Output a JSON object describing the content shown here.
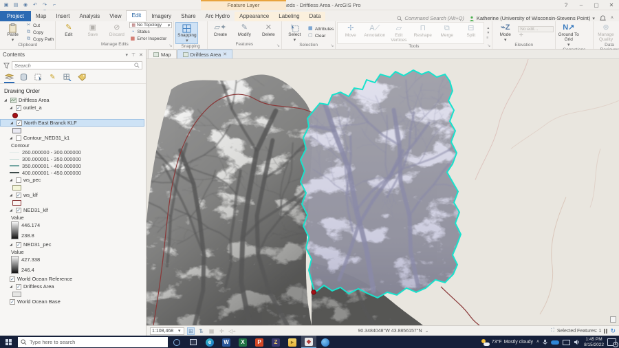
{
  "titlebar": {
    "title": "TwoWatersheds - Driftless Area - ArcGIS Pro",
    "contextual_tab_group": "Feature Layer",
    "help": "?"
  },
  "ribbon": {
    "tabs": [
      "Project",
      "Map",
      "Insert",
      "Analysis",
      "View",
      "Edit",
      "Imagery",
      "Share",
      "Arc Hydro",
      "Appearance",
      "Labeling",
      "Data"
    ],
    "active_tab": "Edit",
    "command_search": "Command Search (Alt+Q)",
    "user": "Katherine (University of Wisconsin-Stevens Point)",
    "groups": {
      "clipboard": {
        "label": "Clipboard",
        "paste": "Paste",
        "cut": "Cut",
        "copy": "Copy",
        "copy_path": "Copy Path"
      },
      "manage_edits": {
        "label": "Manage Edits",
        "edit": "Edit",
        "save": "Save",
        "discard": "Discard",
        "topology": "No Topology",
        "status": "Status",
        "error_inspector": "Error Inspector"
      },
      "snapping": {
        "label": "Snapping",
        "button": "Snapping"
      },
      "features": {
        "label": "Features",
        "create": "Create",
        "modify": "Modify",
        "delete": "Delete"
      },
      "selection": {
        "label": "Selection",
        "select": "Select",
        "attributes": "Attributes",
        "clear": "Clear"
      },
      "tools": {
        "label": "Tools",
        "move": "Move",
        "annotation": "Annotation",
        "edit_vertices": "Edit Vertices",
        "reshape": "Reshape",
        "merge": "Merge",
        "split": "Split"
      },
      "elevation": {
        "label": "Elevation",
        "mode": "Mode",
        "field_placeholder": "No edit..."
      },
      "corrections": {
        "label": "Corrections",
        "ground_to_grid": "Ground To Grid"
      },
      "data_reviewer": {
        "label": "Data Reviewer",
        "manage_quality": "Manage Quality"
      }
    }
  },
  "contents": {
    "title": "Contents",
    "search_placeholder": "Search",
    "drawing_order": "Drawing Order",
    "layers": {
      "map_group": "Driftless Area",
      "outlet": "outlet_a",
      "north_east": "North East Branck KLF",
      "contour": "Contour_NED31_k1",
      "contour_heading": "Contour",
      "contour_classes": [
        "260.000000 - 300.000000",
        "300.000001 - 350.000000",
        "350.000001 - 400.000000",
        "400.000001 - 450.000000"
      ],
      "ws_pec": "ws_pec",
      "ws_klf": "ws_klf",
      "ned_klf": "NED31_klf",
      "ned_klf_value": "Value",
      "ned_klf_max": "446.174",
      "ned_klf_min": "238.8",
      "ned_pec": "NED31_pec",
      "ned_pec_value": "Value",
      "ned_pec_max": "427.338",
      "ned_pec_min": "246.4",
      "world_ocean_reference": "World Ocean Reference",
      "driftless_area": "Driftless Area",
      "world_ocean_base": "World Ocean Base"
    }
  },
  "map": {
    "tab_map": "Map",
    "tab_view": "Driftless Area",
    "scale": "1:108,468",
    "coordinates": "90.3484048°W 43.8856157°N",
    "selected_features": "Selected Features: 1",
    "colors": {
      "selection_outline": "#17e3cd",
      "watershed_boundary": "#8a3838",
      "outlet_point": "#a50f15",
      "selected_fill": "#d7d7e8",
      "basemap": "#e9e6df",
      "contour_class_colors": [
        "#e3ebe9",
        "#bcd7d2",
        "#74a6a2",
        "#3d4a4a"
      ]
    }
  },
  "taskbar": {
    "search_placeholder": "Type here to search",
    "temperature": "73°F",
    "condition": "Mostly cloudy",
    "time": "1:45 PM",
    "date": "8/15/2022",
    "notification_count": "4"
  }
}
